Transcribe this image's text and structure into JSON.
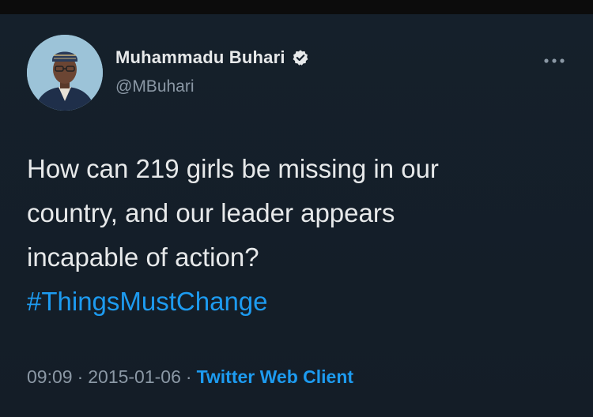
{
  "tweet": {
    "author": {
      "display_name": "Muhammadu Buhari",
      "handle": "@MBuhari",
      "verified": true
    },
    "text_lines": [
      "How can 219 girls be missing in our",
      "country, and our leader appears",
      "incapable of action?"
    ],
    "hashtag": "#ThingsMustChange",
    "time": "09:09",
    "date": "2015-01-06",
    "separator": "·",
    "source": "Twitter Web Client"
  },
  "icons": {
    "verified": "verified-badge-icon",
    "more": "more-options-icon"
  },
  "colors": {
    "background": "#15202b",
    "link": "#1d9bf0",
    "text": "#e7e9ea",
    "secondary": "#8b98a5"
  }
}
